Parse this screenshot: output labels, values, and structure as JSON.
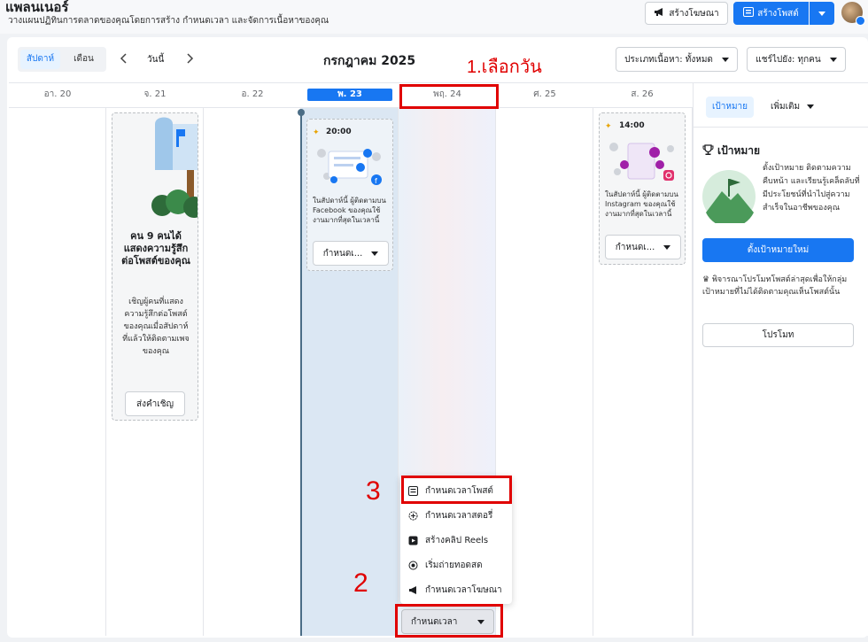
{
  "header": {
    "title": "แพลนเนอร์",
    "subtitle": "วางแผนปฏิทินการตลาดของคุณโดยการสร้าง กำหนดเวลา และจัดการเนื้อหาของคุณ",
    "create_ad_label": "สร้างโฆษณา",
    "create_post_label": "สร้างโพสต์"
  },
  "toolbar": {
    "view_week": "สัปดาห์",
    "view_month": "เดือน",
    "today": "วันนี้",
    "month_title": "กรกฎาคม 2025",
    "content_type_filter": "ประเภทเนื้อหา: ทั้งหมด",
    "shared_filter": "แชร์ไปยัง: ทุกคน"
  },
  "days": [
    {
      "label": "อา. 20"
    },
    {
      "label": "จ. 21"
    },
    {
      "label": "อ. 22"
    },
    {
      "label": "พ. 23"
    },
    {
      "label": "พฤ. 24"
    },
    {
      "label": "ศ. 25"
    },
    {
      "label": "ส. 26"
    }
  ],
  "invite_card": {
    "title": "คน 9 คนได้แสดงความรู้สึกต่อโพสต์ของคุณ",
    "body": "เชิญผู้คนที่แสดงความรู้สึกต่อโพสต์ของคุณเมื่อสัปดาห์ที่แล้วให้ติดตามเพจของคุณ",
    "button": "ส่งคำเชิญ"
  },
  "fb_card": {
    "time": "20:00",
    "body": "ในสัปดาห์นี้ ผู้ติดตามบน Facebook ของคุณใช้งานมากที่สุดในเวลานี้",
    "button": "กำหนดเ..."
  },
  "ig_card": {
    "time": "14:00",
    "body": "ในสัปดาห์นี้ ผู้ติดตามบน Instagram ของคุณใช้งานมากที่สุดในเวลานี้",
    "button": "กำหนดเ..."
  },
  "sidebar": {
    "tab_goals": "เป้าหมาย",
    "tab_more": "เพิ่มเติม",
    "goals_title": "เป้าหมาย",
    "goals_body": "ตั้งเป้าหมาย ติดตามความคืบหน้า และเรียนรู้เคล็ดลับที่มีประโยชน์ที่นำไปสู่ความสำเร็จในอาชีพของคุณ",
    "new_goal_button": "ตั้งเป้าหมายใหม่",
    "promote_text": "พิจารณาโปรโมทโพสต์ล่าสุดเพื่อให้กลุ่มเป้าหมายที่ไม่ได้ติดตามคุณเห็นโพสต์นั้น",
    "promote_button": "โปรโมท"
  },
  "schedule_menu": {
    "items": [
      {
        "label": "กำหนดเวลาโพสต์",
        "icon": "post-icon"
      },
      {
        "label": "กำหนดเวลาสตอรี่",
        "icon": "story-icon"
      },
      {
        "label": "สร้างคลิป Reels",
        "icon": "reels-icon"
      },
      {
        "label": "เริ่มถ่ายทอดสด",
        "icon": "live-icon"
      },
      {
        "label": "กำหนดเวลาโฆษณา",
        "icon": "megaphone-icon"
      }
    ],
    "button": "กำหนดเวลา"
  },
  "annotations": {
    "step1": "1.เลือกวัน",
    "step2": "2",
    "step3": "3"
  },
  "colors": {
    "accent": "#1877f2",
    "annotation": "#e00000",
    "selected_day_bg": "#dbe7f3"
  }
}
